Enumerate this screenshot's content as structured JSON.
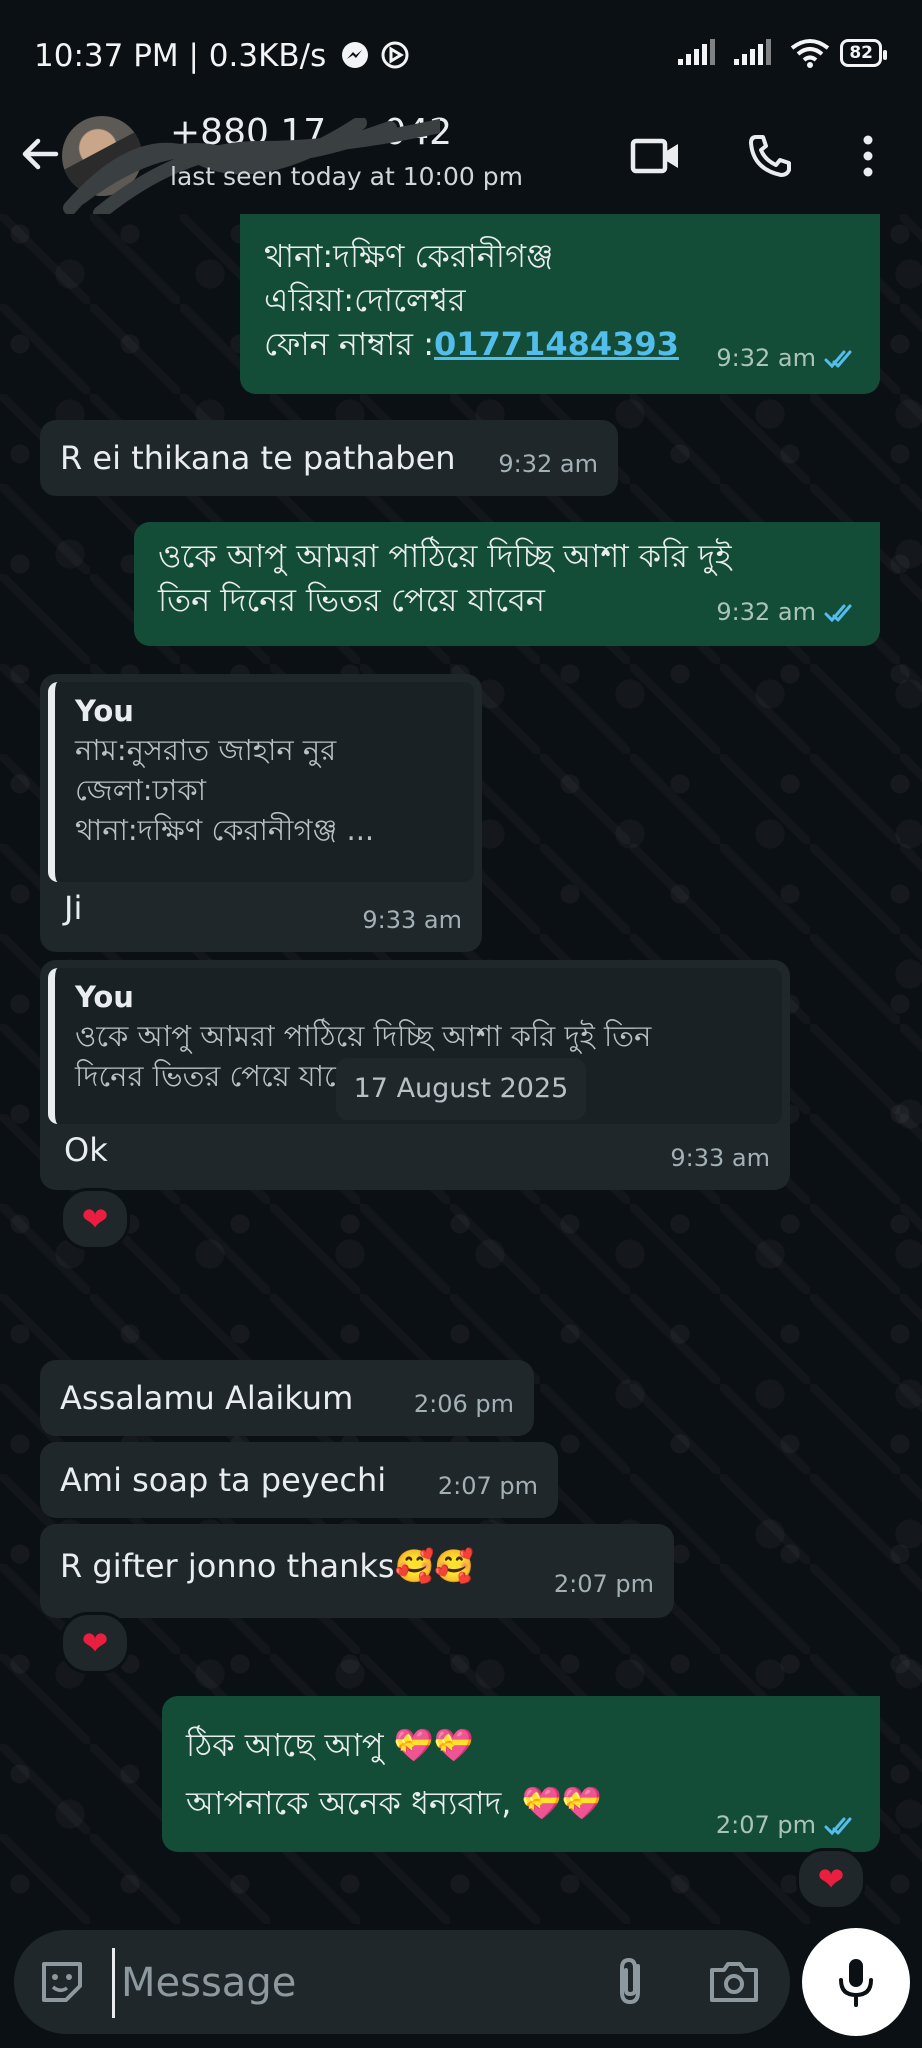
{
  "status_bar": {
    "time_speed": "10:37 PM | 0.3KB/s",
    "battery": "82"
  },
  "header": {
    "contact_name": "+880 17 ....042",
    "last_seen": "last seen today at 10:00 pm"
  },
  "messages": [
    {
      "dir": "out",
      "lines": [
        "থানা:দক্ষিণ কেরানীগঞ্জ",
        "এরিয়া:দোলেশ্বর"
      ],
      "phone_label": "ফোন নাম্বার :",
      "phone": "01771484393",
      "time": "9:32 am",
      "read": true
    },
    {
      "dir": "in",
      "text": "R ei thikana te pathaben",
      "time": "9:32 am"
    },
    {
      "dir": "out",
      "lines": [
        "ওকে আপু আমরা পাঠিয়ে দিচ্ছি আশা করি দুই",
        "তিন দিনের ভিতর পেয়ে যাবেন"
      ],
      "time": "9:32 am",
      "read": true
    },
    {
      "dir": "in",
      "quote_author": "You",
      "quote_lines": [
        "নাম:নুসরাত জাহান নুর",
        "জেলা:ঢাকা",
        "থানা:দক্ষিণ কেরানীগঞ্জ ..."
      ],
      "text": "Ji",
      "time": "9:33 am"
    },
    {
      "dir": "in",
      "quote_author": "You",
      "quote_lines": [
        "ওকে আপু আমরা পাঠিয়ে দিচ্ছি আশা করি দুই তিন",
        "দিনের ভিতর পেয়ে যাবেন"
      ],
      "text": "Ok",
      "time": "9:33 am",
      "reaction": "❤"
    },
    {
      "dir": "in",
      "text": "Assalamu Alaikum",
      "time": "2:06 pm"
    },
    {
      "dir": "in",
      "text": "Ami soap ta peyechi",
      "time": "2:07 pm"
    },
    {
      "dir": "in",
      "text": "R gifter jonno thanks🥰🥰",
      "time": "2:07 pm",
      "reaction": "❤"
    },
    {
      "dir": "out",
      "lines": [
        "ঠিক আছে আপু 💝💝",
        "আপনাকে অনেক ধন্যবাদ, 💝💝"
      ],
      "time": "2:07 pm",
      "read": true,
      "reaction": "❤"
    }
  ],
  "date_separator": "17 August 2025",
  "composer": {
    "placeholder": "Message"
  },
  "colors": {
    "background": "#0b1014",
    "incoming_bubble": "#1f272a",
    "outgoing_bubble": "#144d37",
    "read_ticks": "#53bdeb"
  }
}
